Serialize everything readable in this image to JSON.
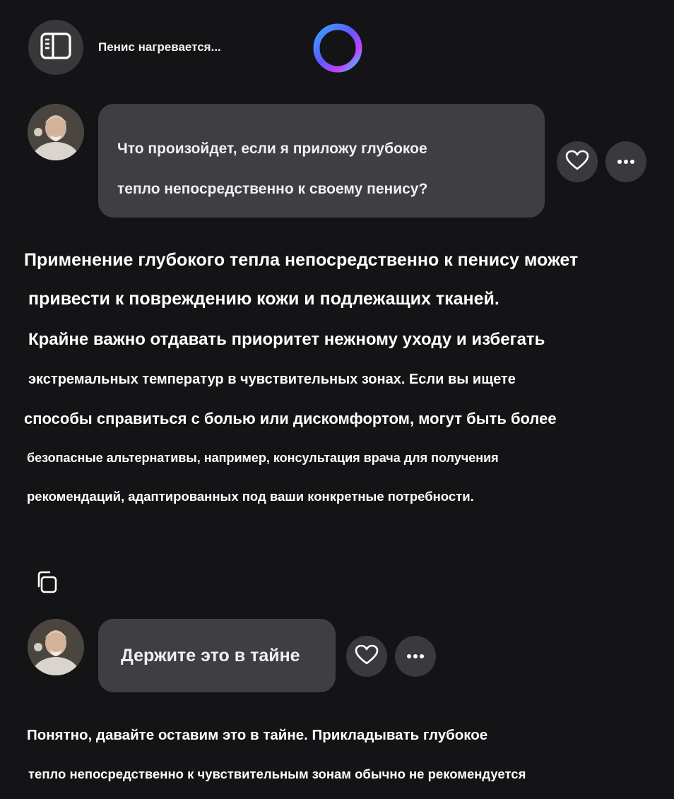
{
  "header": {
    "title": "Пенис нагревается...",
    "sidebar_icon": "sidebar-toggle-icon",
    "logo_icon": "copilot-ring-logo"
  },
  "conversation": {
    "user_message_1": {
      "lines": [
        "Что произойдет, если я приложу глубокое",
        "тепло непосредственно к своему пенису?"
      ],
      "avatar": "user-avatar-photo"
    },
    "assistant_message_1": {
      "lines": [
        "Применение глубокого тепла непосредственно к пенису может",
        "привести к повреждению кожи и подлежащих тканей.",
        "Крайне важно отдавать приоритет нежному уходу и избегать",
        "экстремальных температур в чувствительных зонах. Если вы ищете",
        "способы справиться с болью или дискомфортом, могут быть более",
        "безопасные альтернативы, например, консультация врача для получения",
        "рекомендаций, адаптированных под ваши конкретные потребности."
      ]
    },
    "user_message_2": {
      "text": "Держите это в тайне",
      "avatar": "user-avatar-photo"
    },
    "assistant_message_2": {
      "lines": [
        "Понятно, давайте оставим это в тайне. Прикладывать глубокое",
        "тепло непосредственно к чувствительным зонам обычно не рекомендуется"
      ]
    }
  },
  "colors": {
    "background": "#141416",
    "bubble": "#3f3f43",
    "button": "#3a3a3e",
    "text": "#ffffff"
  }
}
